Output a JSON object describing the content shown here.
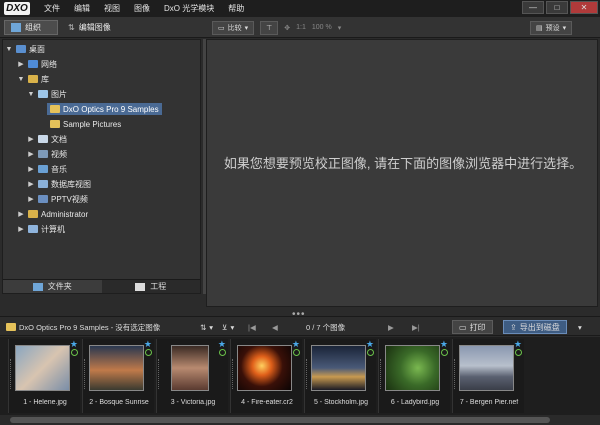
{
  "menubar": {
    "logo": "DXO",
    "items": [
      "文件",
      "编辑",
      "视图",
      "图像",
      "DxO 光学模块",
      "帮助"
    ],
    "controls": [
      "—",
      "□",
      "✕"
    ]
  },
  "toolbar": {
    "tabs": [
      "组织",
      "编辑图像"
    ],
    "compare_label": "比较",
    "zoom_small": "1:1",
    "zoom_pct": "100 %",
    "preset_label": "预设"
  },
  "tree": {
    "items": [
      {
        "label": "桌面",
        "expander": "▼"
      },
      {
        "label": "网络",
        "expander": "▶"
      },
      {
        "label": "库",
        "expander": "▼"
      },
      {
        "label": "图片",
        "expander": "▼"
      },
      {
        "label": "DxO Optics Pro 9 Samples",
        "expander": ""
      },
      {
        "label": "Sample Pictures",
        "expander": ""
      },
      {
        "label": "文档",
        "expander": "▶"
      },
      {
        "label": "视频",
        "expander": "▶"
      },
      {
        "label": "音乐",
        "expander": "▶"
      },
      {
        "label": "数据库视图",
        "expander": "▶"
      },
      {
        "label": "PPTV视频",
        "expander": "▶"
      },
      {
        "label": "Administrator",
        "expander": "▶"
      },
      {
        "label": "计算机",
        "expander": "▶"
      }
    ],
    "bottom_tabs": [
      "文件夹",
      "工程"
    ]
  },
  "viewer": {
    "message": "如果您想要预览校正图像, 请在下面的图像浏览器中进行选择。"
  },
  "filmbar": {
    "path": "DxO Optics Pro 9 Samples - 没有选定图像",
    "count": "0 / 7 个图像",
    "print_label": "打印",
    "export_label": "导出到磁盘"
  },
  "thumbnails": [
    {
      "name": "1 - Helene.jpg"
    },
    {
      "name": "2 - Bosque Sunrise"
    },
    {
      "name": "3 - Victoria.jpg"
    },
    {
      "name": "4 - Fire-eater.cr2"
    },
    {
      "name": "5 - Stockholm.jpg"
    },
    {
      "name": "6 - Ladybird.jpg"
    },
    {
      "name": "7 - Bergen Pier.nef"
    }
  ],
  "colors": {
    "accent": "#4aa8e8",
    "processed": "#6ac24a",
    "selection": "#4a6a94"
  }
}
